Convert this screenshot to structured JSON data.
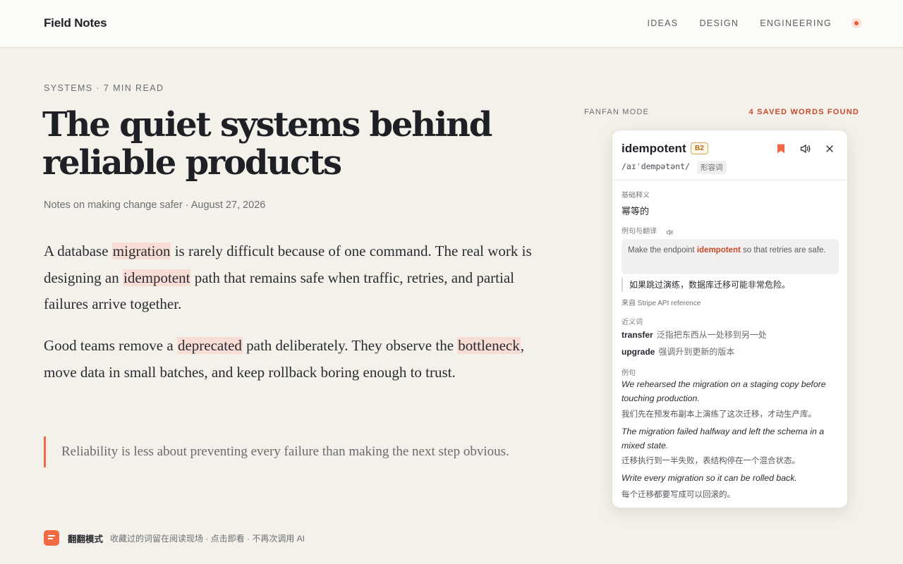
{
  "header": {
    "brand": "Field Notes",
    "nav": [
      "IDEAS",
      "DESIGN",
      "ENGINEERING"
    ]
  },
  "article": {
    "kicker": "SYSTEMS · 7 MIN READ",
    "title": "The quiet systems behind reliable products",
    "byline": "Notes on making change safer · August 27, 2026",
    "p1": {
      "t1": "A database ",
      "w1": "migration",
      "t2": " is rarely difficult because of one command. The real work is designing an ",
      "w2": "idempotent",
      "t3": " path that remains safe when traffic, retries, and partial failures arrive together."
    },
    "p2": {
      "t1": "Good teams remove a ",
      "w1": "deprecated",
      "t2": " path deliberately. They observe the ",
      "w2": "bottleneck",
      "t3": ", move data in small batches, and keep rollback boring enough to trust."
    },
    "quote": "Reliability is less about preventing every failure than making the next step obvious."
  },
  "footer": {
    "title": "翻翻模式",
    "desc": "收藏过的词留在阅读现场 · 点击即看 · 不再次调用 AI"
  },
  "sidebar": {
    "mode_label": "FANFAN MODE",
    "saved_count": "4 SAVED WORDS FOUND"
  },
  "card": {
    "word": "idempotent",
    "level": "B2",
    "phonetic": "/aɪˈdempətənt/",
    "pos": "形容词",
    "basic_label": "基础释义",
    "basic_def": "幂等的",
    "example_label": "例句与翻译",
    "example": {
      "pre": "Make the endpoint ",
      "word": "idempotent",
      "post": " so that retries are safe."
    },
    "example_translation": "如果跳过演练，数据库迁移可能非常危险。",
    "source": "来自 Stripe API reference",
    "synonyms_label": "近义词",
    "synonyms": [
      {
        "word": "transfer",
        "def": "泛指把东西从一处移到另一处"
      },
      {
        "word": "upgrade",
        "def": "强调升到更新的版本"
      }
    ],
    "examples_label": "例句",
    "examples": [
      {
        "en": "We rehearsed the migration on a staging copy before touching production.",
        "zh": "我们先在预发布副本上演练了这次迁移，才动生产库。"
      },
      {
        "en": "The migration failed halfway and left the schema in a mixed state.",
        "zh": "迁移执行到一半失败，表结构停在一个混合状态。"
      },
      {
        "en": "Write every migration so it can be rolled back.",
        "zh": "每个迁移都要写成可以回滚的。"
      }
    ],
    "icons": [
      "bookmark-icon",
      "speaker-icon",
      "close-icon"
    ],
    "accent": "#ef6a43"
  }
}
